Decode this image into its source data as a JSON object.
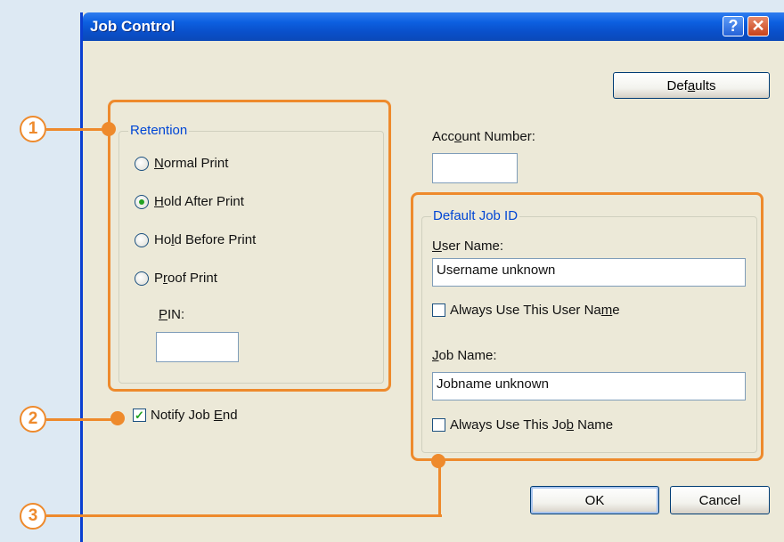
{
  "window": {
    "title": "Job Control",
    "help_glyph": "?",
    "close_glyph": "✕"
  },
  "buttons": {
    "defaults": "Defaults",
    "ok": "OK",
    "cancel": "Cancel"
  },
  "retention": {
    "legend": "Retention",
    "options": [
      {
        "pre": "",
        "u": "N",
        "post": "ormal Print",
        "checked": false
      },
      {
        "pre": "",
        "u": "H",
        "post": "old After Print",
        "checked": true
      },
      {
        "pre": "Ho",
        "u": "l",
        "post": "d Before Print",
        "checked": false
      },
      {
        "pre": "P",
        "u": "r",
        "post": "oof Print",
        "checked": false
      }
    ],
    "pin_label": {
      "pre": "",
      "u": "P",
      "post": "IN:"
    },
    "pin_value": ""
  },
  "account": {
    "label": {
      "pre": "Acc",
      "u": "o",
      "post": "unt Number:"
    },
    "value": ""
  },
  "notify": {
    "label": {
      "pre": "Notify Job ",
      "u": "E",
      "post": "nd"
    },
    "checked": true,
    "check_glyph": "✓"
  },
  "job_id": {
    "legend": "Default Job ID",
    "user_name_label": {
      "pre": "",
      "u": "U",
      "post": "ser Name:"
    },
    "user_name_value": "Username unknown",
    "always_user": {
      "pre": "Always Use This User Na",
      "u": "m",
      "post": "e",
      "checked": false
    },
    "job_name_label": {
      "pre": "",
      "u": "J",
      "post": "ob Name:"
    },
    "job_name_value": "Jobname unknown",
    "always_job": {
      "pre": "Always Use This Jo",
      "u": "b",
      "post": " Name",
      "checked": false
    }
  },
  "callouts": [
    "1",
    "2",
    "3"
  ],
  "colors": {
    "accent": "#ee8a2c",
    "titlebar": "#0a4fc9",
    "group_legend": "#0046d5"
  }
}
